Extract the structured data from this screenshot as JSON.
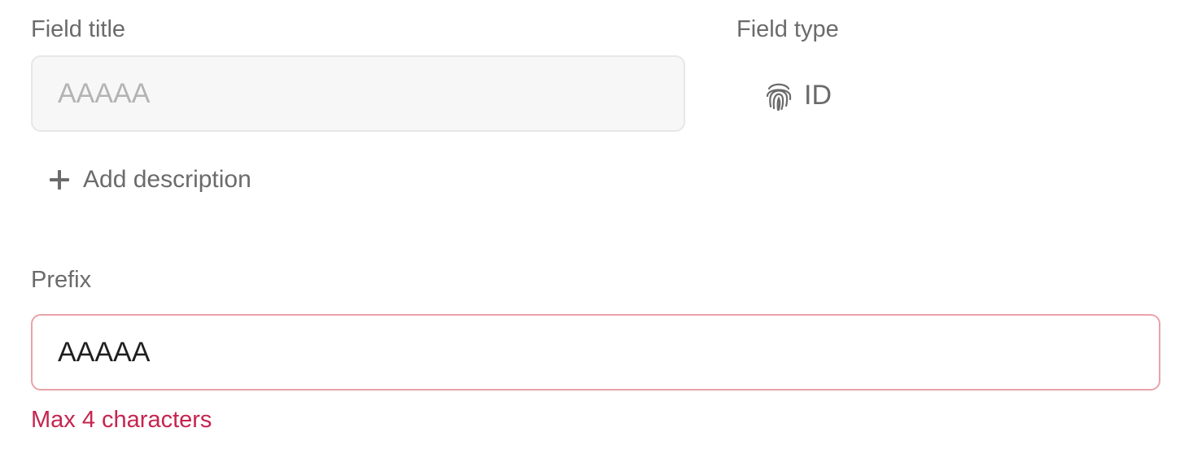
{
  "field_title": {
    "label": "Field title",
    "placeholder": "AAAAA",
    "value": ""
  },
  "field_type": {
    "label": "Field type",
    "icon": "fingerprint-icon",
    "value": "ID"
  },
  "add_description": {
    "icon": "plus-icon",
    "label": "Add description"
  },
  "prefix": {
    "label": "Prefix",
    "value": "AAAAA",
    "error": "Max 4 characters"
  },
  "colors": {
    "label_text": "#6b6b6b",
    "error_red": "#c5254f",
    "error_border": "#e9a3aa",
    "disabled_background": "#f7f7f7"
  }
}
